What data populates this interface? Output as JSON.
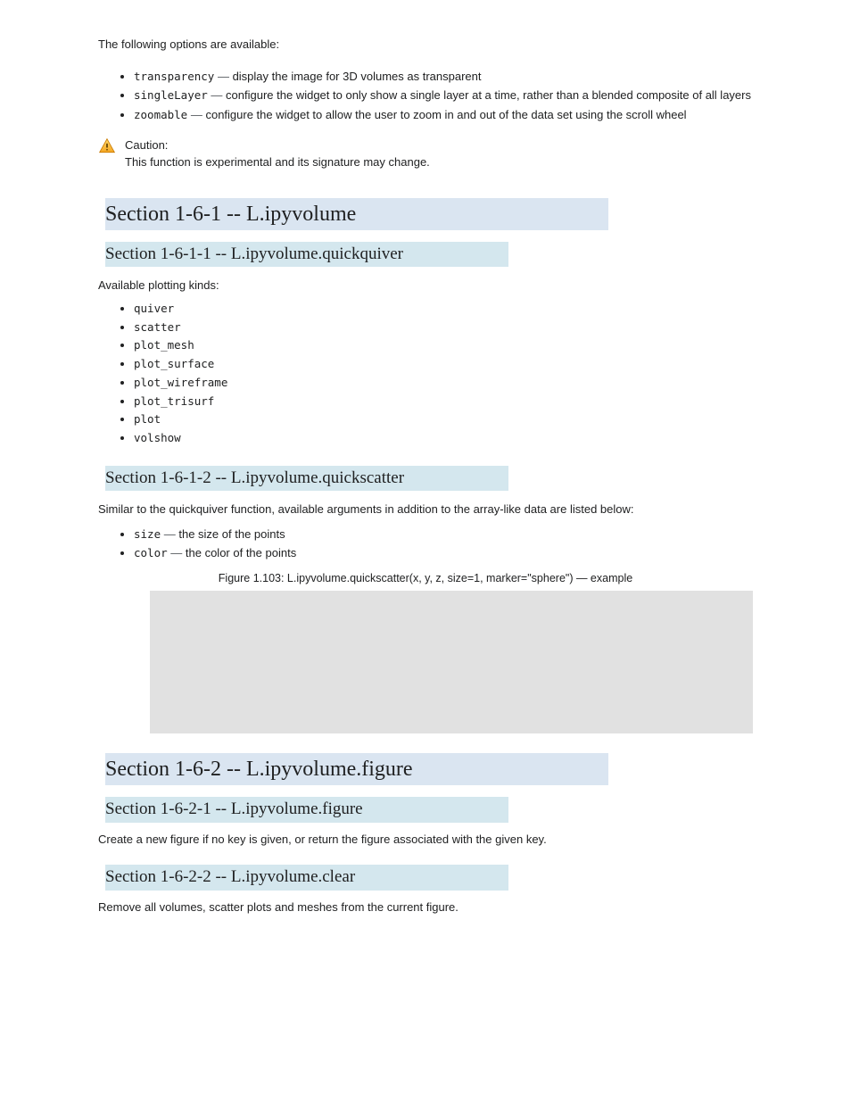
{
  "intro": "The following options are available:",
  "options": [
    {
      "code": "transparency",
      "dash": "—",
      "desc": "display the image for 3D volumes as transparent"
    },
    {
      "code": "singleLayer",
      "dash": "—",
      "desc": "configure the widget to only show a single layer at a time, rather than a blended composite of all layers"
    },
    {
      "code": "zoomable",
      "dash": "—",
      "desc": "configure the widget to allow the user to zoom in and out of the data set using the scroll wheel"
    }
  ],
  "caution": "Caution:\nThis function is experimental and its signature may change.",
  "s1": {
    "title": "Section 1-6-1 -- L.ipyvolume"
  },
  "s1_1": {
    "title": "Section 1-6-1-1 -- L.ipyvolume.quickquiver",
    "desc": "Available plotting kinds:",
    "kinds": [
      "quiver",
      "scatter",
      "plot_mesh",
      "plot_surface",
      "plot_wireframe",
      "plot_trisurf",
      "plot",
      "volshow"
    ]
  },
  "s1_2": {
    "title": "Section 1-6-1-2 -- L.ipyvolume.quickscatter",
    "body": "Similar to the quickquiver function, available arguments in addition to the array-like data are listed below:",
    "args": [
      {
        "code": "size",
        "dash": "—",
        "desc": "the size of the points"
      },
      {
        "code": "color",
        "dash": "—",
        "desc": "the color of the points"
      }
    ],
    "figure_caption": "Figure 1.103: L.ipyvolume.quickscatter(x, y, z, size=1, marker=\"sphere\") — example"
  },
  "s2": {
    "title": "Section 1-6-2 -- L.ipyvolume.figure"
  },
  "s2_1": {
    "title": "Section 1-6-2-1 -- L.ipyvolume.figure",
    "body": "Create a new figure if no key is given, or return the figure associated with the given key."
  },
  "s2_2": {
    "title": "Section 1-6-2-2 -- L.ipyvolume.clear",
    "body": "Remove all volumes, scatter plots and meshes from the current figure."
  }
}
